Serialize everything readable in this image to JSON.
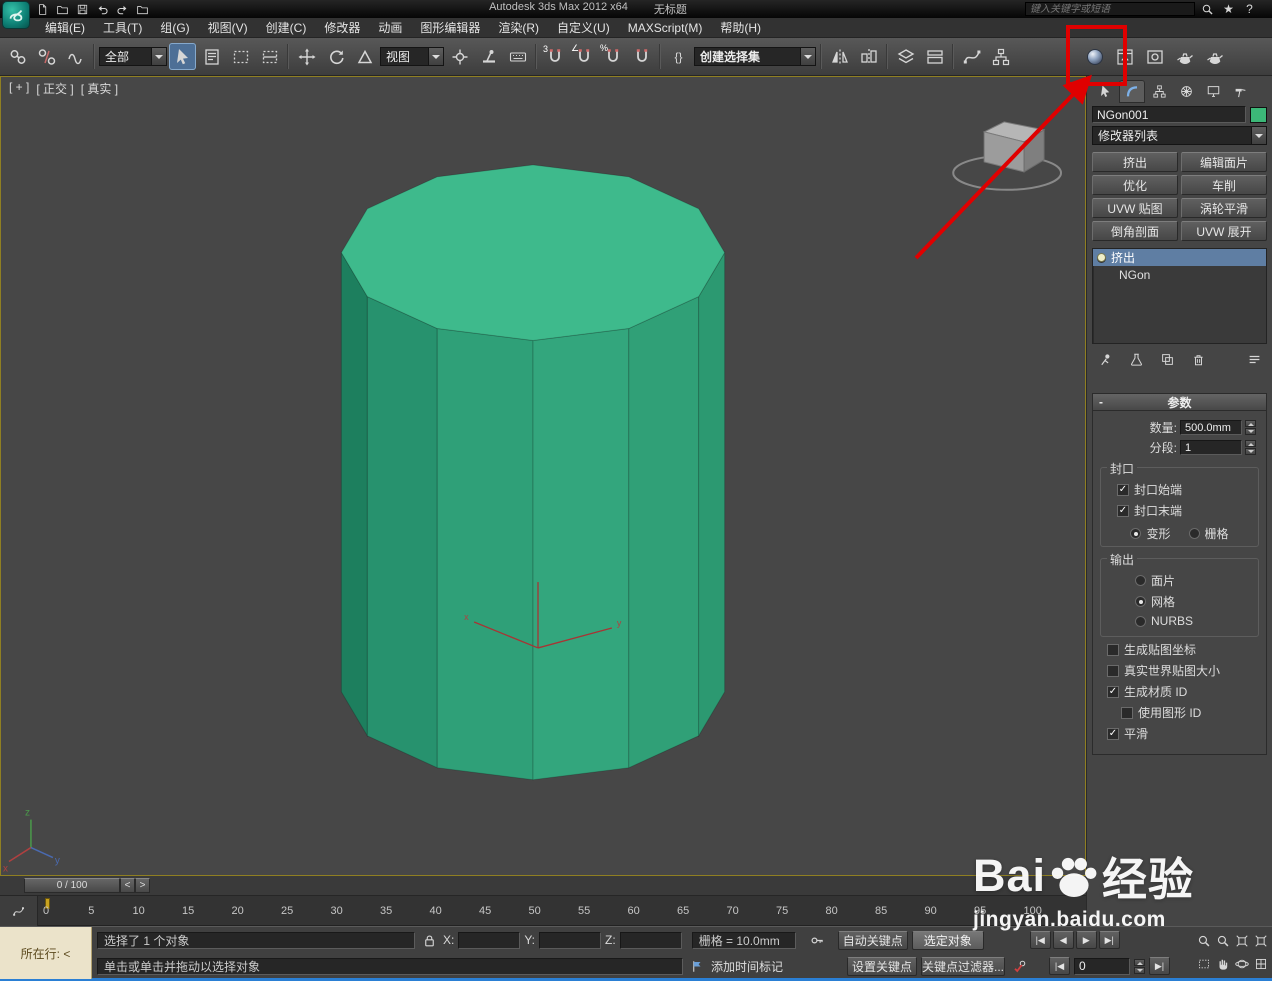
{
  "window": {
    "title": "Autodesk 3ds Max  2012 x64",
    "doc": "无标题",
    "search_placeholder": "键入关键字或短语"
  },
  "menu": {
    "items": [
      "编辑(E)",
      "工具(T)",
      "组(G)",
      "视图(V)",
      "创建(C)",
      "修改器",
      "动画",
      "图形编辑器",
      "渲染(R)",
      "自定义(U)",
      "MAXScript(M)",
      "帮助(H)"
    ]
  },
  "toolbar": {
    "filter": "全部",
    "coord": "视图",
    "selection_set": "创建选择集"
  },
  "viewport": {
    "labels": [
      "[ + ]",
      "[ 正交 ]",
      "[ 真实 ]"
    ],
    "axis_x": "x",
    "axis_y": "y",
    "axis_z": "z"
  },
  "panel": {
    "object_name": "NGon001",
    "modifier_list": "修改器列表",
    "buttons": [
      "挤出",
      "编辑面片",
      "优化",
      "车削",
      "UVW 贴图",
      "涡轮平滑",
      "倒角剖面",
      "UVW 展开"
    ],
    "stack_items": [
      {
        "label": "挤出"
      },
      {
        "label": "NGon"
      }
    ],
    "rollout_title": "参数",
    "amount_label": "数量:",
    "amount_value": "500.0mm",
    "segments_label": "分段:",
    "segments_value": "1",
    "cap_group": "封口",
    "cap_start": "封口始端",
    "cap_end": "封口末端",
    "morph": "变形",
    "grid": "栅格",
    "output_group": "输出",
    "patch": "面片",
    "mesh": "网格",
    "nurbs": "NURBS",
    "gen_mapping": "生成贴图坐标",
    "real_world_map": "真实世界贴图大小",
    "gen_mat_id": "生成材质 ID",
    "use_shape_id": "使用图形 ID",
    "smooth": "平滑"
  },
  "timeline": {
    "slider": "0 / 100",
    "ticks": [
      "0",
      "5",
      "10",
      "15",
      "20",
      "25",
      "30",
      "35",
      "40",
      "45",
      "50",
      "55",
      "60",
      "65",
      "70",
      "75",
      "80",
      "85",
      "90",
      "95",
      "100"
    ]
  },
  "status": {
    "corner_label": "所在行: <",
    "selected_info": "选择了 1 个对象",
    "prompt": "单击或单击并拖动以选择对象",
    "x_label": "X:",
    "y_label": "Y:",
    "z_label": "Z:",
    "grid_info": "栅格 = 10.0mm",
    "add_time_tag": "添加时间标记",
    "auto_key": "自动关键点",
    "set_key": "设置关键点",
    "key_filter_selected": "选定对象",
    "key_filters": "关键点过滤器...",
    "frame": "0"
  },
  "watermark": {
    "bai": "Bai",
    "brand": "经验",
    "url": "jingyan.baidu.com"
  },
  "colors": {
    "object": "#3cb878",
    "top_face": "#3eba8c",
    "facet0": "#1d7f5e",
    "facet1": "#27926e",
    "facet2": "#2fa078",
    "facet3": "#33a67d",
    "facet4": "#30a077",
    "facet5": "#2c9971",
    "annotation": "#e00000"
  },
  "glyphs": {
    "lt": "<",
    "gt": ">",
    "go_start": "|◀",
    "prev_frame": "◀",
    "play": "▶",
    "go_end": "▶|",
    "prev_key": "|◀",
    "next_key": "▶|",
    "check": "✓",
    "star": "★",
    "question": "?",
    "minus": "-",
    "braces": "{}",
    "three": "3",
    "angle": "∠",
    "percent": "%"
  }
}
